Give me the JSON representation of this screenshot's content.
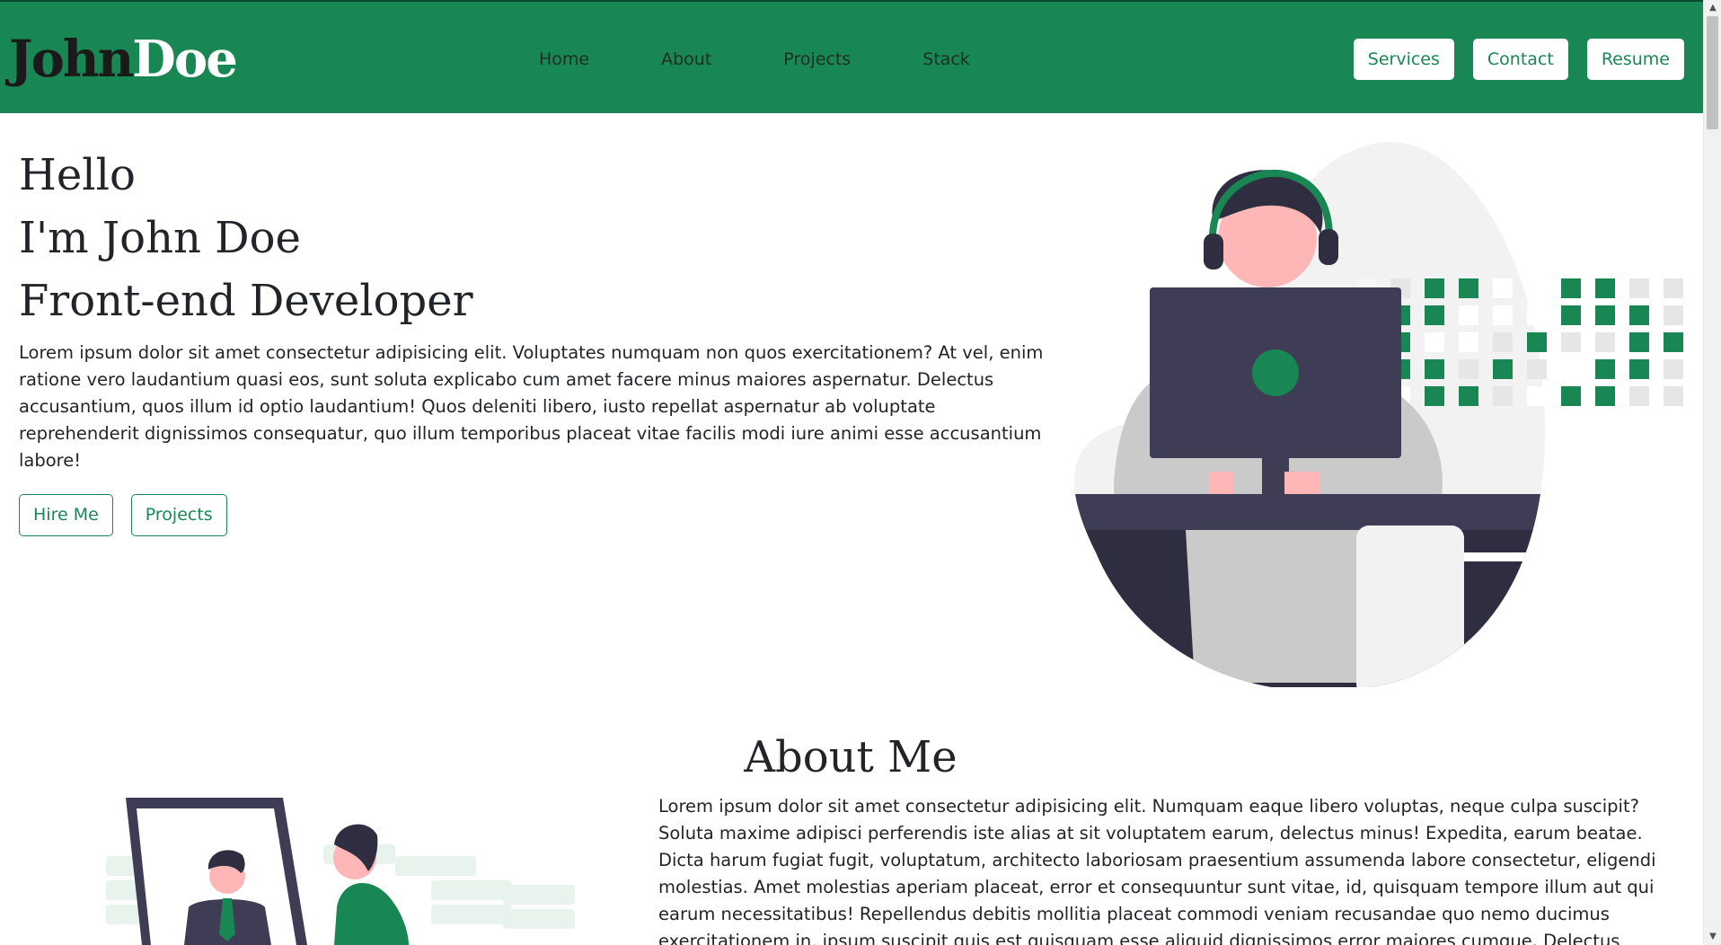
{
  "brand": {
    "part1": "John",
    "part2": "Doe"
  },
  "nav": {
    "links": [
      "Home",
      "About",
      "Projects",
      "Stack"
    ],
    "buttons": [
      "Services",
      "Contact",
      "Resume"
    ]
  },
  "hero": {
    "line1": "Hello",
    "line2": "I'm John Doe",
    "line3": "Front-end Developer",
    "paragraph": "Lorem ipsum dolor sit amet consectetur adipisicing elit. Voluptates numquam non quos exercitationem? At vel, enim ratione vero laudantium quasi eos, sunt soluta explicabo cum amet facere minus maiores aspernatur. Delectus accusantium, quos illum id optio laudantium! Quos deleniti libero, iusto repellat aspernatur ab voluptate reprehenderit dignissimos consequatur, quo illum temporibus placeat vitae facilis modi iure animi esse accusantium labore!",
    "hire_label": "Hire Me",
    "projects_label": "Projects",
    "illustration": "developer-at-computer-illustration"
  },
  "about": {
    "title": "About Me",
    "paragraph": "Lorem ipsum dolor sit amet consectetur adipisicing elit. Numquam eaque libero voluptas, neque culpa suscipit? Soluta maxime adipisci perferendis iste alias at sit voluptatem earum, delectus minus! Expedita, earum beatae. Dicta harum fugiat fugit, voluptatum, architecto laboriosam praesentium assumenda labore consectetur, eligendi molestias. Amet molestias aperiam placeat, error et consequuntur sunt vitae, id, quisquam tempore illum aut qui earum necessitatibus! Repellendus debitis mollitia placeat commodi veniam recusandae quo nemo ducimus exercitationem in, ipsum suscipit quis est quisquam esse aliquid dignissimos error maiores cumque. Delectus sunt doloribus, quos animi iure dolor? Sit",
    "illustration": "man-at-mirror-illustration"
  },
  "colors": {
    "primary": "#198754",
    "dark": "#3f3d56",
    "skin": "#ffb6b6",
    "light_gray": "#f2f2f2"
  }
}
